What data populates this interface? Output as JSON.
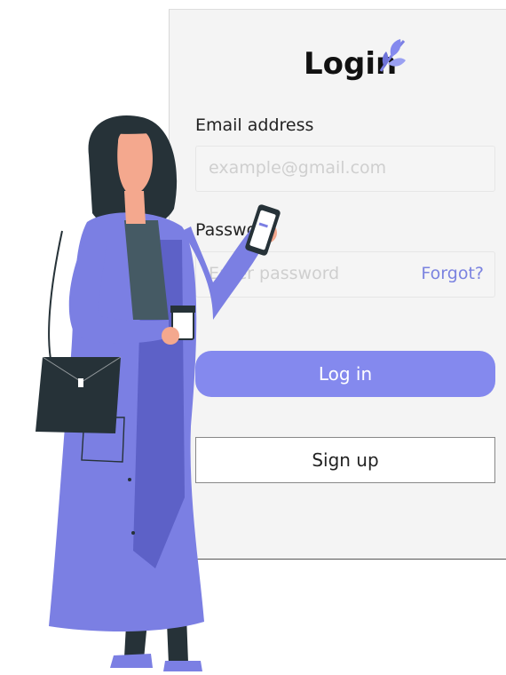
{
  "login": {
    "title": "Login",
    "email_label": "Email address",
    "email_placeholder": "example@gmail.com",
    "password_label": "Password",
    "password_placeholder": "Enter password",
    "forgot_link": "Forgot?",
    "login_button": "Log in",
    "signup_button": "Sign up"
  },
  "colors": {
    "accent": "#8489EE",
    "panel_bg": "#F4F4F4",
    "coat": "#7B7FE3",
    "hair": "#263238"
  },
  "icons": [
    "leaf-icon",
    "phone-icon",
    "coffee-cup-icon",
    "handbag-icon"
  ]
}
